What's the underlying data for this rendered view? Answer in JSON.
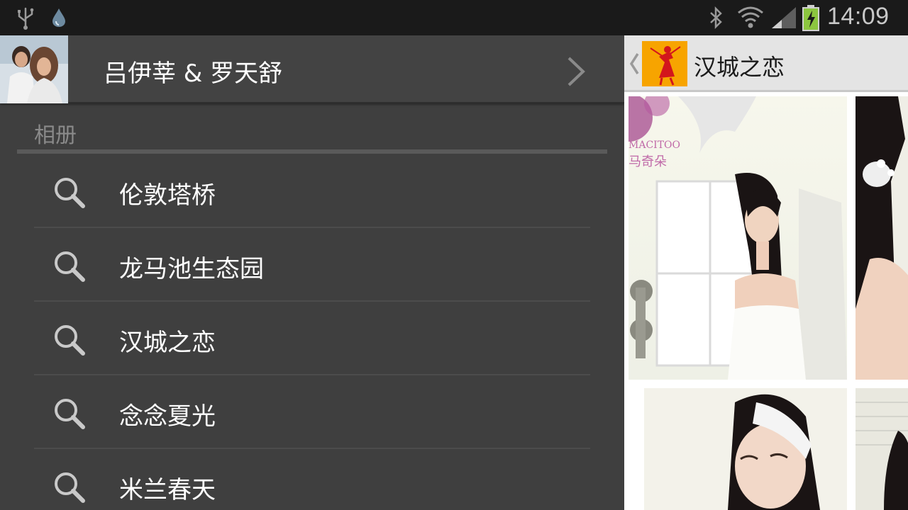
{
  "status_bar": {
    "time": "14:09",
    "icons": [
      "usb-icon",
      "water-drop-icon",
      "bluetooth-icon",
      "wifi-icon",
      "signal-icon",
      "battery-charging-icon"
    ]
  },
  "drawer": {
    "header": {
      "title": "吕伊莘 & 罗天舒",
      "avatar_icon": "couple-photo-avatar",
      "chevron_icon": "chevron-right-icon"
    },
    "section_label": "相册",
    "items": [
      {
        "label": "伦敦塔桥",
        "icon": "search-icon"
      },
      {
        "label": "龙马池生态园",
        "icon": "search-icon"
      },
      {
        "label": "汉城之恋",
        "icon": "search-icon"
      },
      {
        "label": "念念夏光",
        "icon": "search-icon"
      },
      {
        "label": "米兰春天",
        "icon": "search-icon"
      }
    ]
  },
  "content": {
    "action_bar": {
      "title": "汉城之恋",
      "back_icon": "chevron-left-icon",
      "logo_icon": "dancer-logo-icon"
    },
    "photo_watermark_brand": "MACITOO",
    "photo_watermark_cn": "马奇朵"
  }
}
